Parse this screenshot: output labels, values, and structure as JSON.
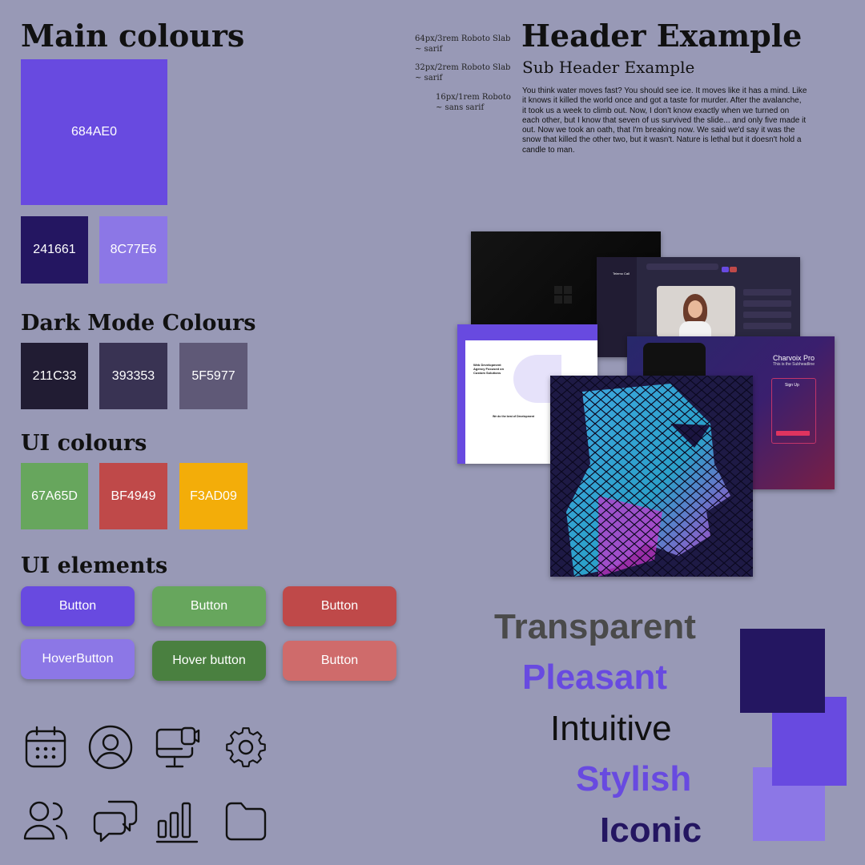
{
  "main_colours": {
    "title": "Main colours",
    "primary": {
      "label": "684AE0",
      "color": "#684AE0"
    },
    "secondary": [
      {
        "label": "241661",
        "color": "#241661"
      },
      {
        "label": "8C77E6",
        "color": "#8C77E6"
      }
    ]
  },
  "dark_mode": {
    "title": "Dark Mode Colours",
    "swatches": [
      {
        "label": "211C33",
        "color": "#211C33"
      },
      {
        "label": "393353",
        "color": "#393353"
      },
      {
        "label": "5F5977",
        "color": "#5F5977"
      }
    ]
  },
  "ui_colours": {
    "title": "UI colours",
    "swatches": [
      {
        "label": "67A65D",
        "color": "#67A65D"
      },
      {
        "label": "BF4949",
        "color": "#BF4949"
      },
      {
        "label": "F3AD09",
        "color": "#F3AD09"
      }
    ]
  },
  "ui_elements": {
    "title": "UI elements",
    "buttons": [
      {
        "label": "Button",
        "color": "#684AE0"
      },
      {
        "label": "Button",
        "color": "#67A65D"
      },
      {
        "label": "Button",
        "color": "#BF4949"
      },
      {
        "label": "HoverButton",
        "color": "#8C77E6"
      },
      {
        "label": "Hover button",
        "color": "#4A8040"
      },
      {
        "label": "Button",
        "color": "#CF6B6B"
      }
    ]
  },
  "icons": [
    "calendar-icon",
    "user-circle-icon",
    "monitor-webcam-icon",
    "gear-icon",
    "users-icon",
    "chat-bubbles-icon",
    "bar-chart-icon",
    "folder-icon"
  ],
  "typography": {
    "header": "Header Example",
    "subheader": "Sub Header Example",
    "spec_header": "64px/3rem Roboto Slab ~ sarif",
    "spec_subheader": "32px/2rem Roboto Slab ~ sarif",
    "spec_body": "16px/1rem Roboto ~ sans sarif",
    "body": "You think water moves fast? You should see ice. It moves like it has a mind. Like it knows it killed the world once and got a taste for murder. After the avalanche, it took us a week to climb out. Now, I don't know exactly when we turned on each other, but I know that seven of us survived the slide... and only five made it out. Now we took an oath, that I'm breaking now. We said we'd say it was the snow that killed the other two, but it wasn't. Nature is lethal but it doesn't hold a candle to man."
  },
  "mockups": {
    "dashboard_title": "Telemo Call",
    "web_heading": "Web Development Agency Focused on Custom Solutions",
    "web_subheading": "We do the best of Development",
    "app_title": "Charvoix Pro",
    "app_subtitle": "This is the Subheadline",
    "app_signup": "Sign Up"
  },
  "keywords": [
    {
      "text": "Transparent",
      "color": "#4A4A4A"
    },
    {
      "text": "Pleasant",
      "color": "#684AE0"
    },
    {
      "text": "Intuitive",
      "color": "#111111"
    },
    {
      "text": "Stylish",
      "color": "#684AE0"
    },
    {
      "text": "Iconic",
      "color": "#241661"
    }
  ],
  "decor_colors": [
    "#241661",
    "#684AE0",
    "#8C77E6"
  ]
}
